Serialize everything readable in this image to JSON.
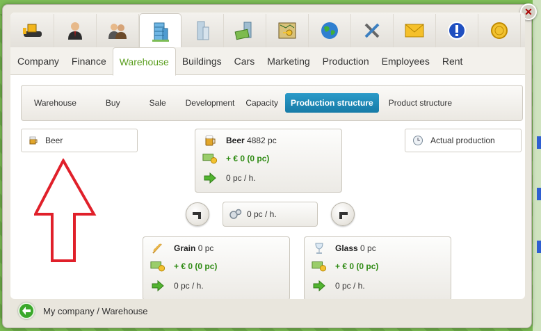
{
  "icon_tabs": [
    {
      "name": "bulldozer-icon"
    },
    {
      "name": "businessman-icon"
    },
    {
      "name": "people-icon"
    },
    {
      "name": "warehouse-building-icon",
      "active": true
    },
    {
      "name": "office-building-icon"
    },
    {
      "name": "money-building-icon"
    },
    {
      "name": "map-key-icon"
    },
    {
      "name": "globe-icon"
    },
    {
      "name": "tools-icon"
    },
    {
      "name": "mail-icon"
    },
    {
      "name": "info-icon"
    },
    {
      "name": "coin-icon"
    }
  ],
  "tabs": [
    "Company",
    "Finance",
    "Warehouse",
    "Buildings",
    "Cars",
    "Marketing",
    "Production",
    "Employees",
    "Rent"
  ],
  "active_tab": "Warehouse",
  "subnav": [
    "Warehouse",
    "Buy",
    "Sale",
    "Development",
    "Capacity",
    "Production structure",
    "Product structure"
  ],
  "active_subnav": "Production structure",
  "product_select": {
    "label": "Beer"
  },
  "actual_production": {
    "label": "Actual production"
  },
  "main_product": {
    "name": "Beer",
    "qty": "4882 pc",
    "money": "+ € 0 (0 pc)",
    "rate": "0 pc / h."
  },
  "machine": {
    "rate": "0 pc / h."
  },
  "inputs": [
    {
      "name": "Grain",
      "qty": "0 pc",
      "money": "+ € 0 (0 pc)",
      "rate": "0 pc / h."
    },
    {
      "name": "Glass",
      "qty": "0 pc",
      "money": "+ € 0 (0 pc)",
      "rate": "0 pc / h."
    }
  ],
  "footer": {
    "breadcrumb": "My company / Warehouse"
  },
  "colors": {
    "accent_green": "#5a9e1e",
    "active_blue": "#1f89b8",
    "money_green": "#2d8a12",
    "arrow_red": "#e0202a"
  }
}
